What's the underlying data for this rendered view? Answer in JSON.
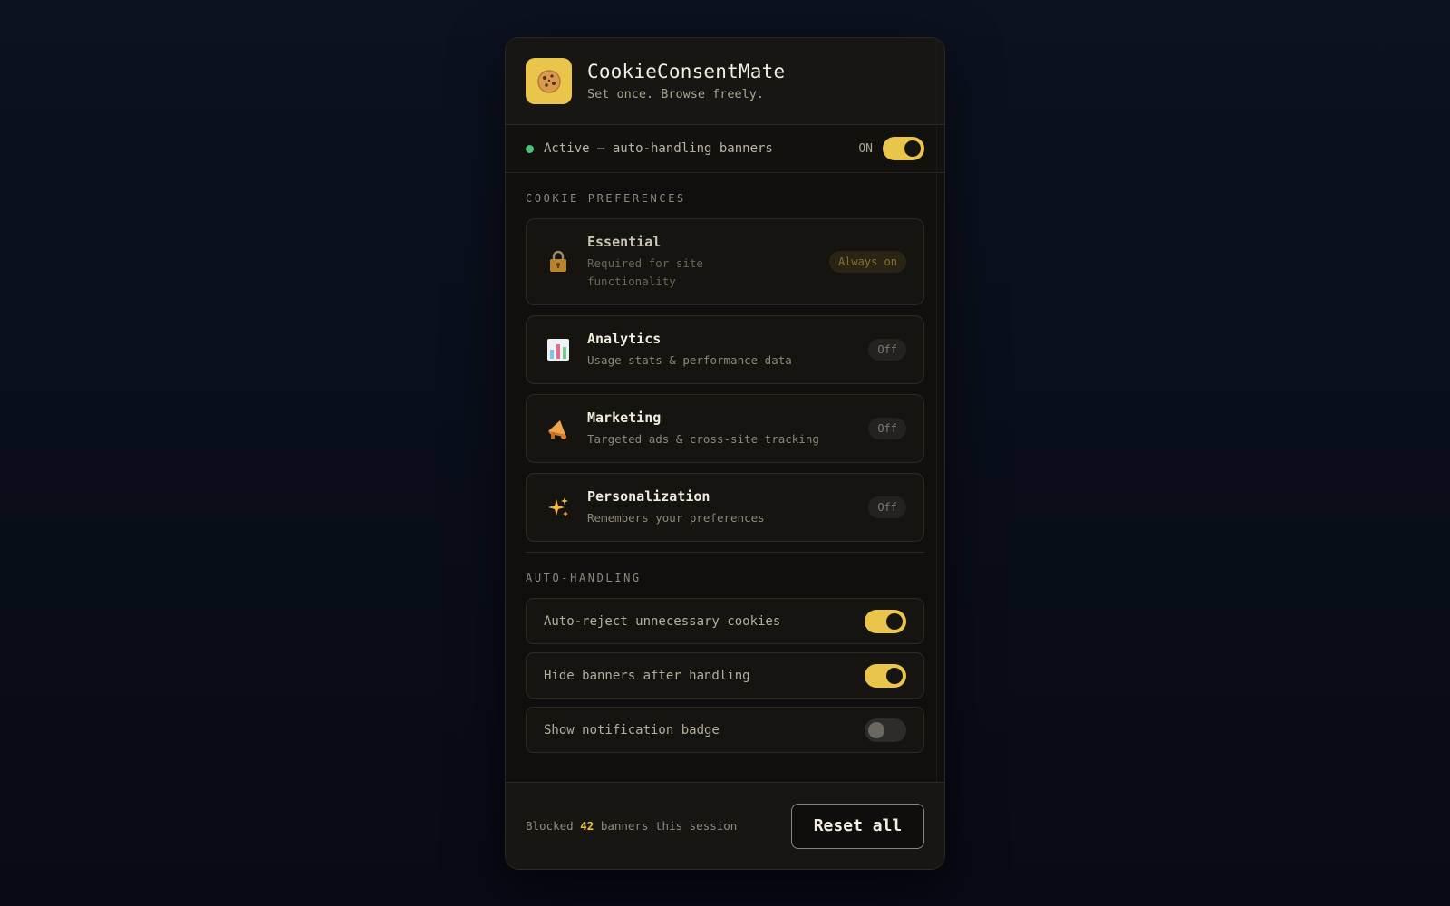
{
  "app": {
    "name": "CookieConsentMate",
    "tagline": "Set once. Browse freely.",
    "logo_icon": "cookie-icon"
  },
  "status": {
    "text": "Active — auto-handling banners",
    "toggle_label": "ON",
    "enabled": true
  },
  "preferences": {
    "title": "COOKIE PREFERENCES",
    "items": [
      {
        "name": "Essential",
        "desc_line1": "Required for site",
        "desc_line2": "functionality",
        "badge": "Always on",
        "icon": "lock-icon"
      },
      {
        "name": "Analytics",
        "desc": "Usage stats & performance data",
        "badge": "Off",
        "icon": "bar-chart-icon"
      },
      {
        "name": "Marketing",
        "desc": "Targeted ads & cross-site tracking",
        "badge": "Off",
        "icon": "megaphone-icon"
      },
      {
        "name": "Personalization",
        "desc": "Remembers your preferences",
        "badge": "Off",
        "icon": "sparkles-icon"
      }
    ]
  },
  "auto_handling": {
    "title": "AUTO-HANDLING",
    "items": [
      {
        "label": "Auto-reject unnecessary cookies",
        "enabled": true
      },
      {
        "label": "Hide banners after handling",
        "enabled": true
      },
      {
        "label": "Show notification badge",
        "enabled": false
      }
    ]
  },
  "footer": {
    "prefix": "Blocked",
    "count": "42",
    "suffix": "banners this session",
    "reset_label": "Reset all"
  },
  "colors": {
    "accent": "#e9c549",
    "status_active": "#4ec27a",
    "background": "#0b1220"
  }
}
